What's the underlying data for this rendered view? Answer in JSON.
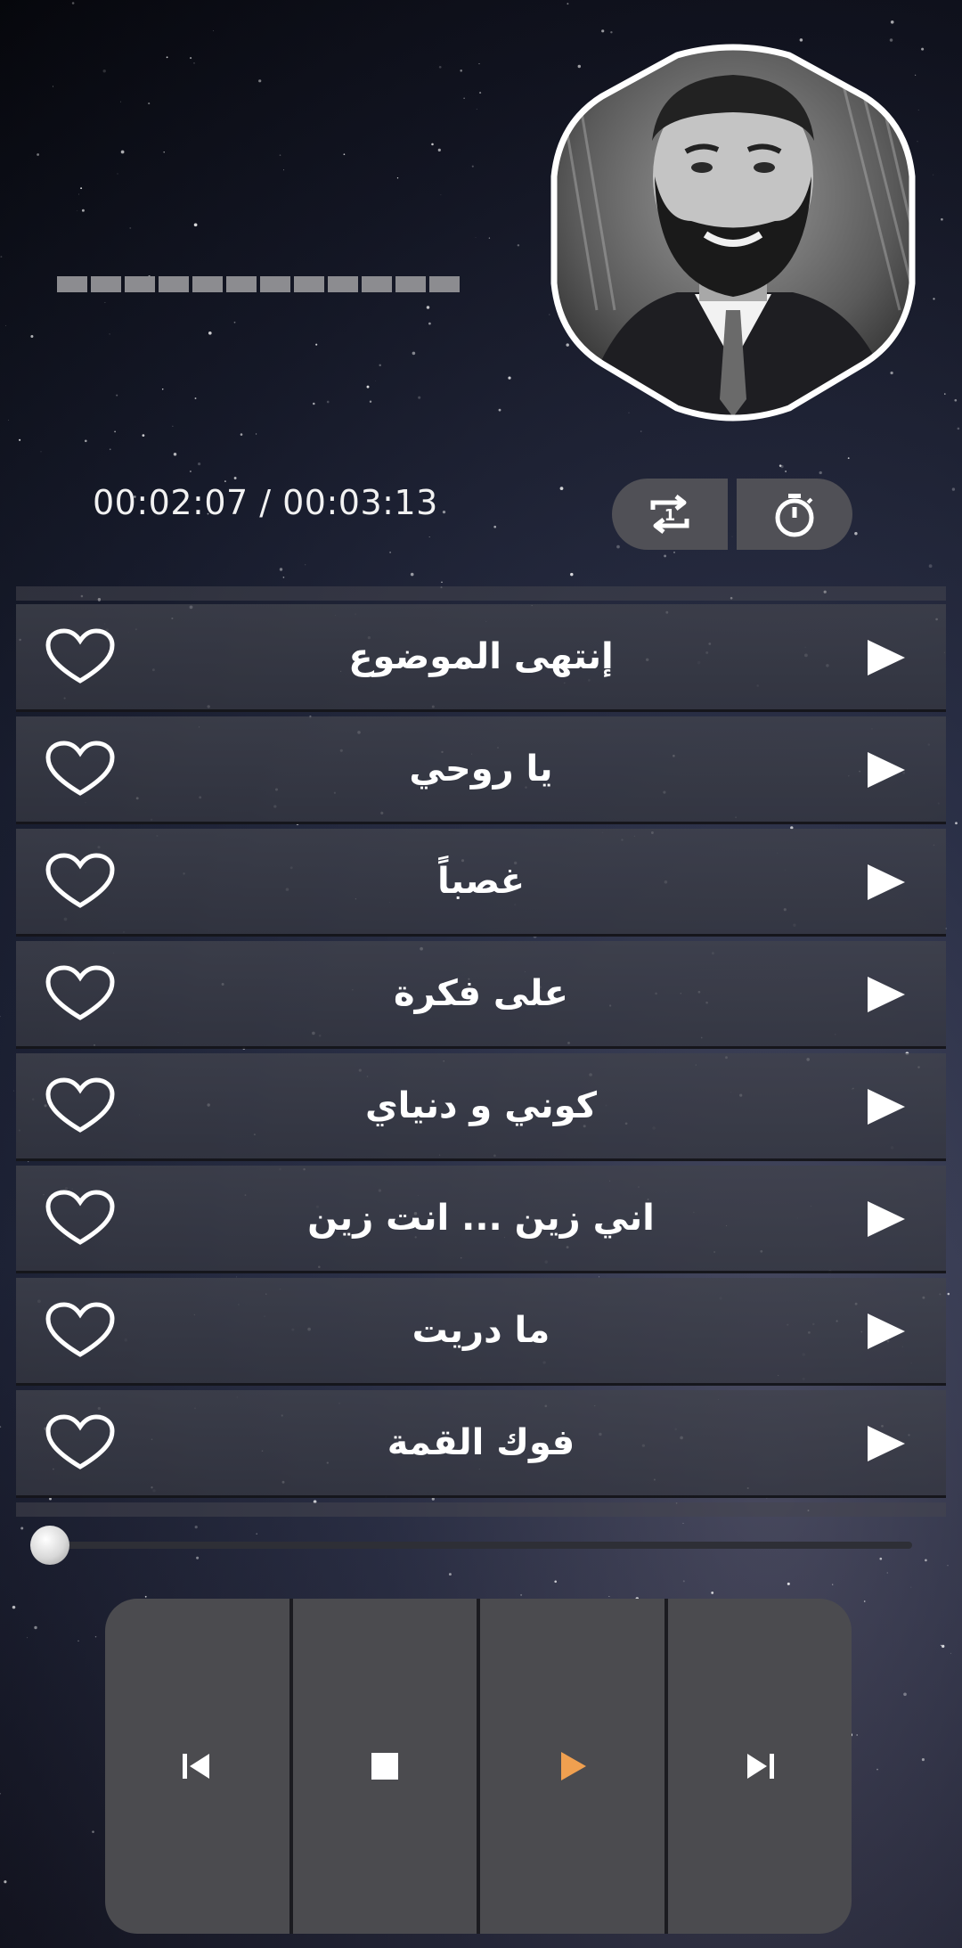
{
  "player": {
    "time_display": "00:02:07 / 00:03:13",
    "progress": 0.0
  },
  "icons": {
    "repeat": "repeat-one-icon",
    "timer": "timer-icon",
    "favorite": "heart-outline-icon",
    "play": "play-triangle-icon"
  },
  "playlist": {
    "tracks": [
      {
        "title": "إنتهى الموضوع"
      },
      {
        "title": "يا روحي"
      },
      {
        "title": "غصباً"
      },
      {
        "title": "على فكرة"
      },
      {
        "title": "كوني و دنياي"
      },
      {
        "title": "اني زين ... انت زين"
      },
      {
        "title": "ما دريت"
      },
      {
        "title": "فوك القمة"
      }
    ]
  },
  "transport": {
    "buttons": [
      "previous",
      "stop",
      "play",
      "next"
    ],
    "accent_color": "#f0a050"
  },
  "colors": {
    "row_bg": "#41434d",
    "button_bg": "#4b4b4f",
    "pill_bg": "#505056"
  }
}
